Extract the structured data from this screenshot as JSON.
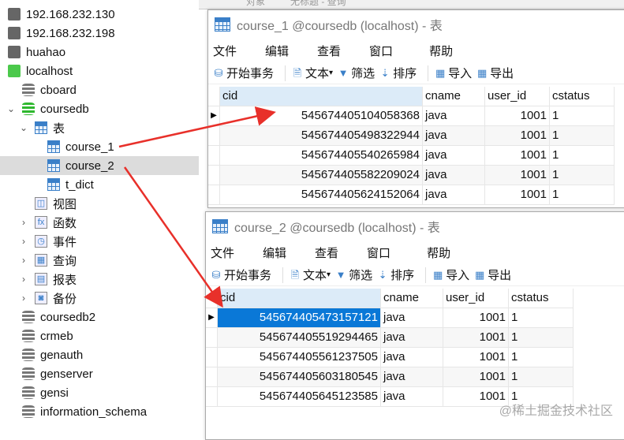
{
  "topbar": {
    "tab1": "对象",
    "tab2": "无标题 - 查询"
  },
  "sidebar": {
    "items": [
      {
        "label": "192.168.232.130",
        "type": "server"
      },
      {
        "label": "192.168.232.198",
        "type": "server"
      },
      {
        "label": "huahao",
        "type": "server"
      },
      {
        "label": "localhost",
        "type": "server-on"
      },
      {
        "label": "cboard",
        "type": "db"
      },
      {
        "label": "coursedb",
        "type": "db-on"
      },
      {
        "label": "表",
        "type": "tables"
      },
      {
        "label": "course_1",
        "type": "table"
      },
      {
        "label": "course_2",
        "type": "table"
      },
      {
        "label": "t_dict",
        "type": "table"
      },
      {
        "label": "视图",
        "type": "views"
      },
      {
        "label": "函数",
        "type": "functions"
      },
      {
        "label": "事件",
        "type": "events"
      },
      {
        "label": "查询",
        "type": "queries"
      },
      {
        "label": "报表",
        "type": "reports"
      },
      {
        "label": "备份",
        "type": "backups"
      },
      {
        "label": "coursedb2",
        "type": "db"
      },
      {
        "label": "crmeb",
        "type": "db"
      },
      {
        "label": "genauth",
        "type": "db"
      },
      {
        "label": "genserver",
        "type": "db"
      },
      {
        "label": "gensi",
        "type": "db"
      },
      {
        "label": "information_schema",
        "type": "db"
      }
    ]
  },
  "menu": [
    "文件",
    "编辑",
    "查看",
    "窗口",
    "帮助"
  ],
  "toolbar": {
    "begin_tx": "开始事务",
    "text": "文本",
    "filter": "筛选",
    "sort": "排序",
    "import": "导入",
    "export": "导出"
  },
  "columns": [
    "cid",
    "cname",
    "user_id",
    "cstatus"
  ],
  "windows": [
    {
      "title": "course_1 @coursedb (localhost) - 表",
      "rows": [
        [
          "545674405104058368",
          "java",
          "1001",
          "1"
        ],
        [
          "545674405498322944",
          "java",
          "1001",
          "1"
        ],
        [
          "545674405540265984",
          "java",
          "1001",
          "1"
        ],
        [
          "545674405582209024",
          "java",
          "1001",
          "1"
        ],
        [
          "545674405624152064",
          "java",
          "1001",
          "1"
        ]
      ]
    },
    {
      "title": "course_2 @coursedb (localhost) - 表",
      "rows": [
        [
          "545674405473157121",
          "java",
          "1001",
          "1"
        ],
        [
          "545674405519294465",
          "java",
          "1001",
          "1"
        ],
        [
          "545674405561237505",
          "java",
          "1001",
          "1"
        ],
        [
          "545674405603180545",
          "java",
          "1001",
          "1"
        ],
        [
          "545674405645123585",
          "java",
          "1001",
          "1"
        ]
      ]
    }
  ],
  "watermark": "@稀土掘金技术社区",
  "colors": {
    "selection": "#0a78d7",
    "arrow": "#e8302a",
    "header_cid": "#dcebf8"
  }
}
